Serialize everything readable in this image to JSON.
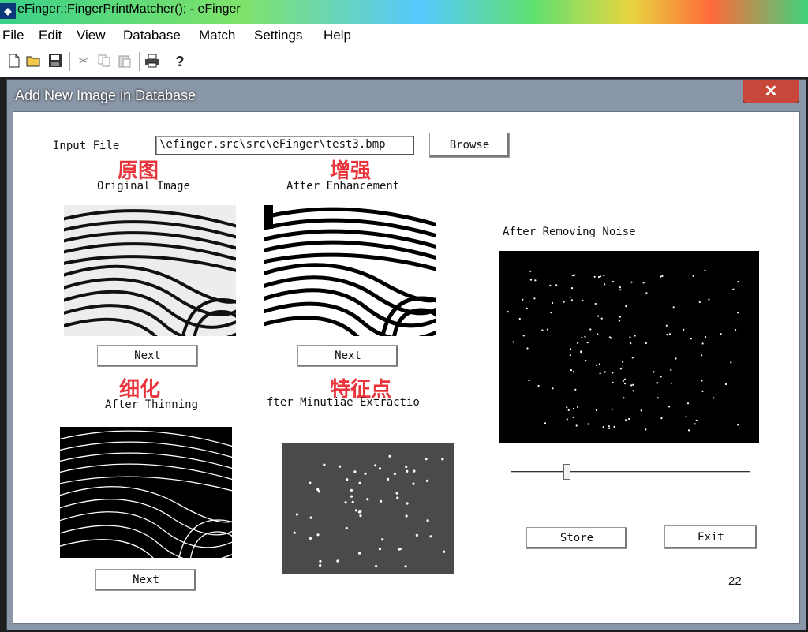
{
  "app": {
    "title": "eFinger::FingerPrintMatcher(); - eFinger",
    "menu": [
      "File",
      "Edit",
      "View",
      "Database",
      "Match",
      "Settings",
      "Help"
    ],
    "toolbar_icons": [
      "new-file-icon",
      "open-folder-icon",
      "save-icon",
      "cut-icon",
      "copy-icon",
      "paste-icon",
      "print-icon",
      "help-icon"
    ]
  },
  "dialog": {
    "title": "Add New Image in Database",
    "close_glyph": "✕",
    "input_file_label": "Input File",
    "input_file_value": "\\efinger.src\\src\\eFinger\\test3.bmp",
    "browse_label": "Browse",
    "panels": {
      "original": {
        "cn": "原图",
        "label": "Original Image",
        "next_label": "Next"
      },
      "enhanced": {
        "cn": "增强",
        "label": "After Enhancement",
        "next_label": "Next"
      },
      "thinning": {
        "cn": "细化",
        "label": "After Thinning",
        "next_label": "Next"
      },
      "minutiae": {
        "cn": "特征点",
        "label": "fter Minutiae Extractio"
      },
      "noise": {
        "label": "After Removing Noise"
      }
    },
    "store_label": "Store",
    "exit_label": "Exit",
    "counter": "22"
  }
}
